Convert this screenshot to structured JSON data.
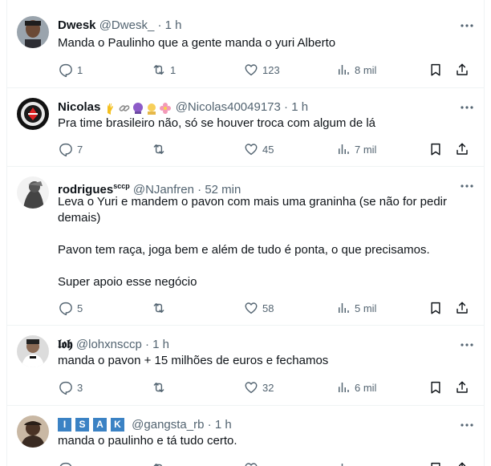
{
  "tweets": [
    {
      "name": "Dwesk",
      "handle": "@Dwesk_",
      "dot": "·",
      "time": "1 h",
      "text": "Manda o Paulinho que a gente manda o yuri Alberto",
      "replies": "1",
      "retweets": "1",
      "likes": "123",
      "views": "8 mil"
    },
    {
      "name": "Nicolas",
      "handle": "@Nicolas40049173",
      "dot": "·",
      "time": "1 h",
      "text": "Pra time brasileiro não, só se houver troca com algum de lá",
      "replies": "7",
      "retweets": "",
      "likes": "45",
      "views": "7 mil"
    },
    {
      "name": "rodrigues",
      "name_sup": "sccp",
      "handle": "@NJanfren",
      "dot": "·",
      "time": "52 min",
      "text": "Leva o Yuri e mandem o pavon com mais uma graninha (se não for pedir demais)\n\nPavon tem raça, joga bem e além de tudo é ponta, o que precisamos.\n\nSuper apoio esse negócio",
      "replies": "5",
      "retweets": "",
      "likes": "58",
      "views": "5 mil"
    },
    {
      "name": "𝖑𝖔𝖍",
      "handle": "@lohxnsccp",
      "dot": "·",
      "time": "1 h",
      "text": "manda o pavon + 15 milhões de euros e fechamos",
      "replies": "3",
      "retweets": "",
      "likes": "32",
      "views": "6 mil"
    },
    {
      "name_letters": [
        "I",
        "S",
        "A",
        "K"
      ],
      "handle": "@gangsta_rb",
      "dot": "·",
      "time": "1 h",
      "text": "manda o paulinho e tá tudo certo."
    }
  ],
  "colors": {
    "text": "#0f1419",
    "secondary": "#536471",
    "border": "#eff3f4",
    "isak_badge": "#3b82c4"
  },
  "icons": {
    "reply": "speech-bubble-icon",
    "retweet": "retweet-icon",
    "like": "heart-icon",
    "views": "bar-chart-icon",
    "bookmark": "bookmark-icon",
    "share": "share-icon",
    "more": "more-horizontal-icon"
  }
}
